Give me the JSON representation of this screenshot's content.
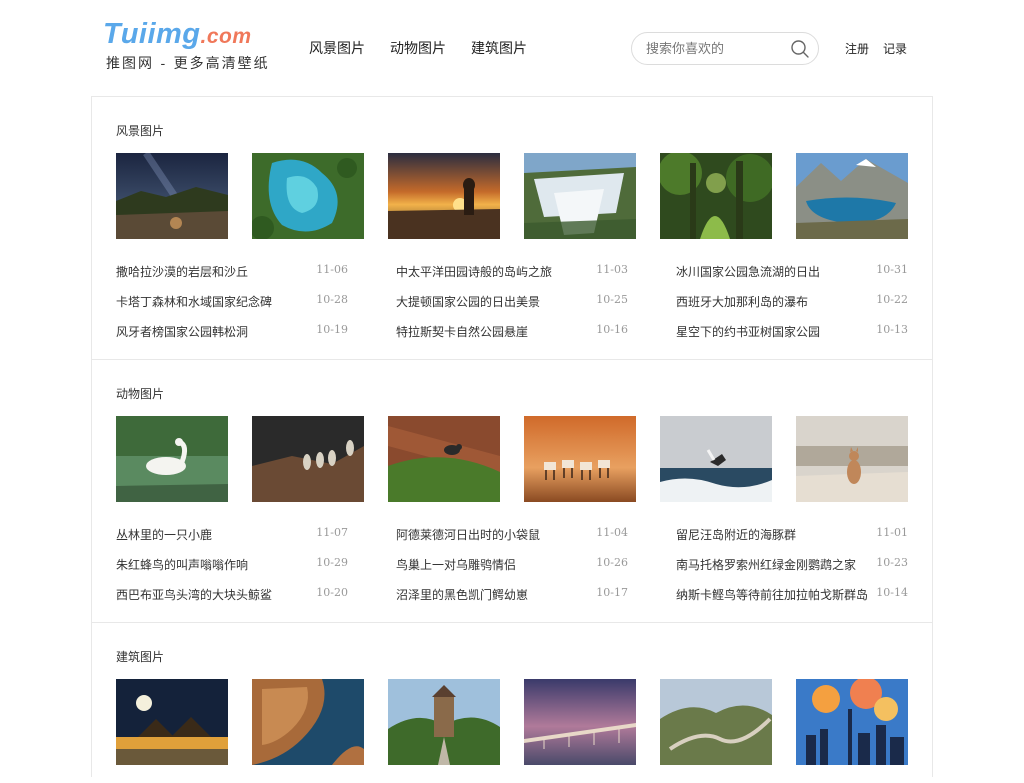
{
  "logo": {
    "name": "Tuiimg",
    "domain": ".com",
    "tagline": "推图网 - 更多高清壁纸"
  },
  "nav": [
    {
      "label": "风景图片"
    },
    {
      "label": "动物图片"
    },
    {
      "label": "建筑图片"
    }
  ],
  "search": {
    "placeholder": "搜索你喜欢的",
    "value": ""
  },
  "auth": {
    "register": "注册",
    "login": "记录"
  },
  "sections": [
    {
      "title": "风景图片",
      "images": [
        "milky-way-rocks",
        "aerial-blue-lagoon",
        "sunset-moai-statue",
        "waterfall-valley",
        "green-forest-path",
        "mountain-lake"
      ],
      "articles": [
        {
          "title": "撒哈拉沙漠的岩层和沙丘",
          "date": "11-06"
        },
        {
          "title": "中太平洋田园诗般的岛屿之旅",
          "date": "11-03"
        },
        {
          "title": "冰川国家公园急流湖的日出",
          "date": "10-31"
        },
        {
          "title": "卡塔丁森林和水域国家纪念碑",
          "date": "10-28"
        },
        {
          "title": "大提顿国家公园的日出美景",
          "date": "10-25"
        },
        {
          "title": "西班牙大加那利岛的瀑布",
          "date": "10-22"
        },
        {
          "title": "风牙者榜国家公园韩松洞",
          "date": "10-19"
        },
        {
          "title": "特拉斯契卡自然公园悬崖",
          "date": "10-16"
        },
        {
          "title": "星空下的约书亚树国家公园",
          "date": "10-13"
        }
      ]
    },
    {
      "title": "动物图片",
      "images": [
        "swan-on-lake",
        "meerkats-on-rock",
        "bird-on-mossy-rock",
        "antelope-herd-sunset",
        "gull-over-waves",
        "cat-on-beach"
      ],
      "articles": [
        {
          "title": "丛林里的一只小鹿",
          "date": "11-07"
        },
        {
          "title": "阿德莱德河日出时的小袋鼠",
          "date": "11-04"
        },
        {
          "title": "留尼汪岛附近的海豚群",
          "date": "11-01"
        },
        {
          "title": "朱红蜂鸟的叫声嗡嗡作响",
          "date": "10-29"
        },
        {
          "title": "鸟巢上一对乌雕鸮情侣",
          "date": "10-26"
        },
        {
          "title": "南马托格罗索州红绿金刚鹦鹉之家",
          "date": "10-23"
        },
        {
          "title": "西巴布亚鸟头湾的大块头鲸鲨",
          "date": "10-20"
        },
        {
          "title": "沼泽里的黑色凯门鳄幼崽",
          "date": "10-17"
        },
        {
          "title": "纳斯卡鲣鸟等待前往加拉帕戈斯群岛",
          "date": "10-14"
        }
      ]
    },
    {
      "title": "建筑图片",
      "images": [
        "moon-over-pagoda",
        "aerial-coastline",
        "castle-road",
        "long-bridge-dusk",
        "great-wall-hills",
        "city-skyline-clouds"
      ],
      "articles": []
    }
  ]
}
